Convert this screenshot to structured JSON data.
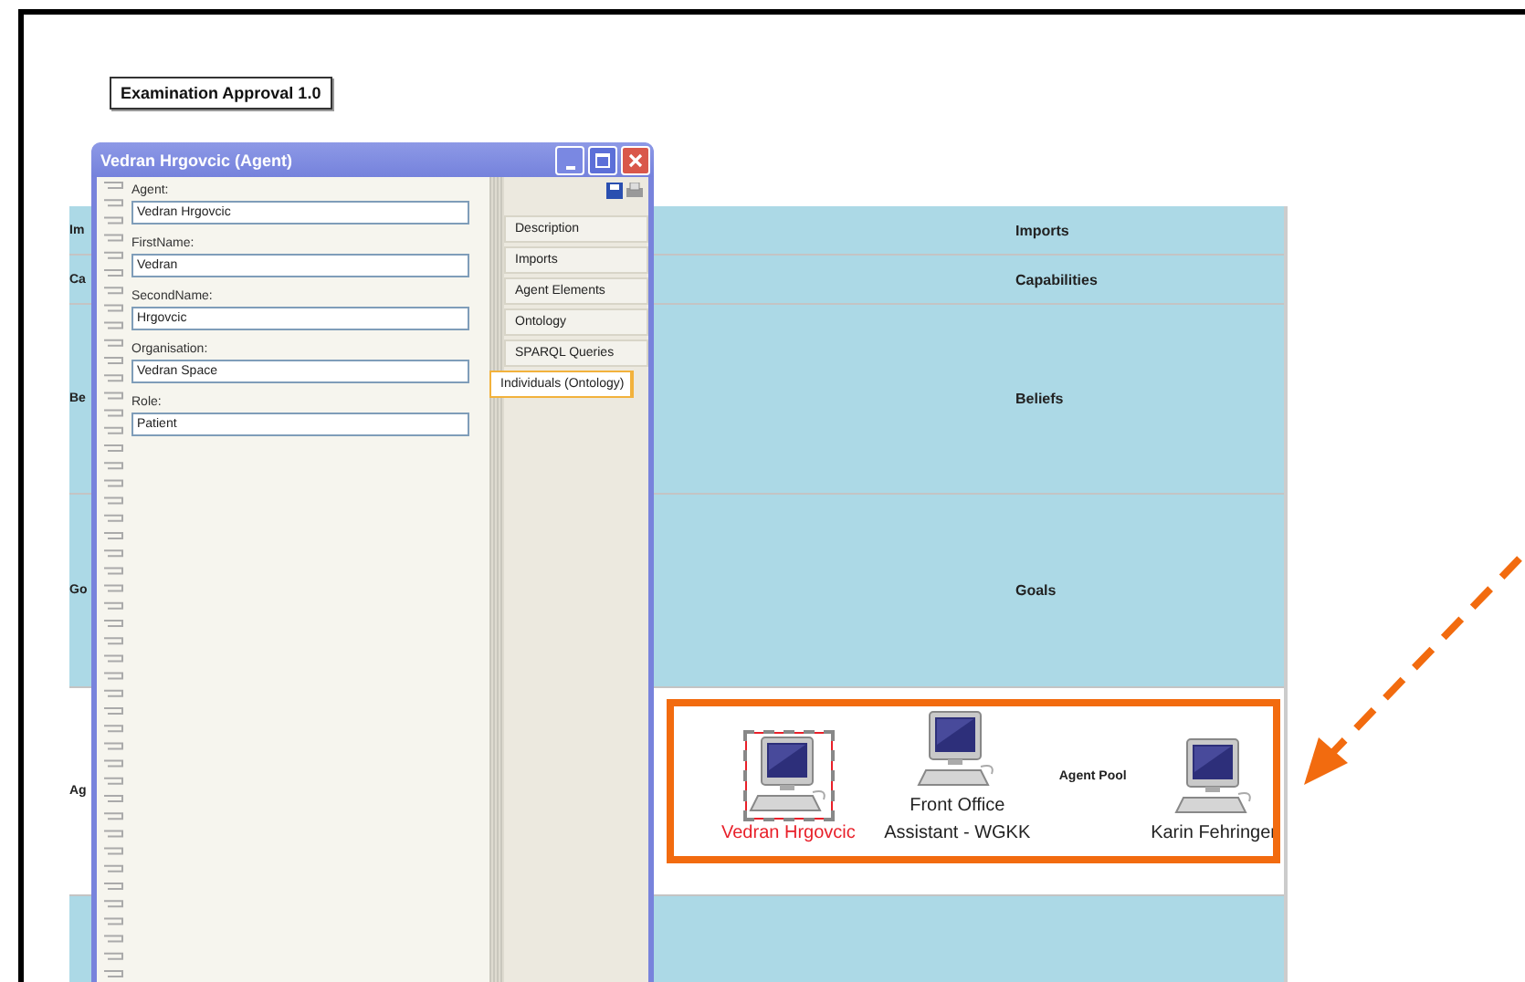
{
  "document": {
    "title": "Examination Approval 1.0"
  },
  "lanes": [
    {
      "kind": "band",
      "label": "Imports",
      "side_label": "Im"
    },
    {
      "kind": "band",
      "label": "Capabilities",
      "side_label": "Ca"
    },
    {
      "kind": "band",
      "label": "Beliefs",
      "side_label": "Be"
    },
    {
      "kind": "band",
      "label": "Goals",
      "side_label": "Go"
    },
    {
      "kind": "pool",
      "label": "Agent Pool",
      "side_label": "Ag",
      "agents": [
        {
          "name": "Vedran Hrgovcic",
          "selected": true
        },
        {
          "name": "Front Office Assistant - WGKK",
          "selected": false
        },
        {
          "name": "Karin Fehringer",
          "selected": false
        }
      ]
    },
    {
      "kind": "band"
    }
  ],
  "dialog": {
    "title": "Vedran Hrgovcic (Agent)",
    "fields": [
      {
        "label": "Agent:",
        "value": "Vedran Hrgovcic"
      },
      {
        "label": "FirstName:",
        "value": "Vedran"
      },
      {
        "label": "SecondName:",
        "value": "Hrgovcic"
      },
      {
        "label": "Organisation:",
        "value": "Vedran Space"
      },
      {
        "label": "Role:",
        "value": "Patient"
      }
    ],
    "tabs": [
      {
        "label": "Description",
        "selected": false
      },
      {
        "label": "Imports",
        "selected": false
      },
      {
        "label": "Agent Elements",
        "selected": false
      },
      {
        "label": "Ontology",
        "selected": false
      },
      {
        "label": "SPARQL Queries",
        "selected": false
      },
      {
        "label": "Individuals (Ontology)",
        "selected": true
      }
    ]
  }
}
